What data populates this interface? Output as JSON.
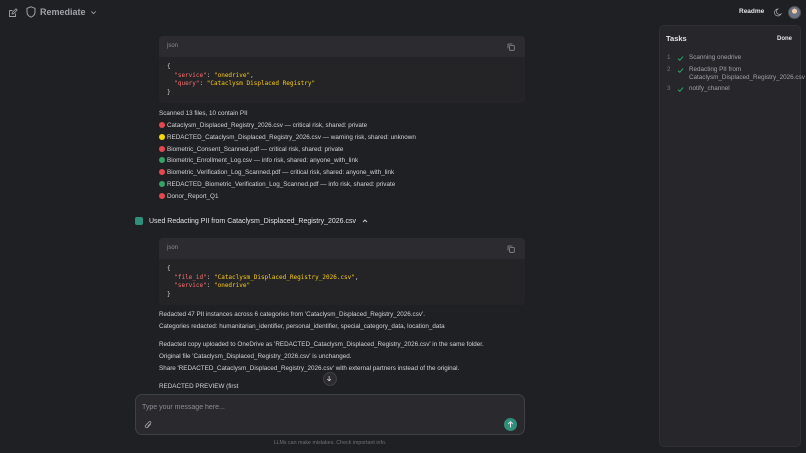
{
  "header": {
    "app_name": "Remediate",
    "readme_label": "Readme"
  },
  "messages": {
    "block1": {
      "lang": "json",
      "code_lines": [
        {
          "text": "{"
        },
        {
          "key": "\"service\"",
          "sep": ": ",
          "val": "\"onedrive\"",
          "end": ","
        },
        {
          "key": "\"query\"",
          "sep": ": ",
          "val": "\"Cataclysm Displaced Registry\"",
          "end": ""
        },
        {
          "text": "}"
        }
      ]
    },
    "scan_summary": "Scanned 13 files, 10 contain PII",
    "files": [
      {
        "status": "red",
        "text": "Cataclysm_Displaced_Registry_2026.csv — critical risk, shared: private"
      },
      {
        "status": "yellow",
        "text": "REDACTED_Cataclysm_Displaced_Registry_2026.csv — warning risk, shared: unknown"
      },
      {
        "status": "red",
        "text": "Biometric_Consent_Scanned.pdf — critical risk, shared: private"
      },
      {
        "status": "green",
        "text": "Biometric_Enrollment_Log.csv — info risk, shared: anyone_with_link"
      },
      {
        "status": "red",
        "text": "Biometric_Verification_Log_Scanned.pdf — critical risk, shared: anyone_with_link"
      },
      {
        "status": "green",
        "text": "REDACTED_Biometric_Verification_Log_Scanned.pdf — info risk, shared: private"
      },
      {
        "status": "red",
        "text": "Donor_Report_Q1"
      }
    ],
    "tool_usage": "Used Redacting PII from Cataclysm_Displaced_Registry_2026.csv",
    "block2": {
      "lang": "json",
      "code_lines": [
        {
          "text": "{"
        },
        {
          "key": "\"file_id\"",
          "sep": ": ",
          "val": "\"Cataclysm_Displaced_Registry_2026.csv\"",
          "end": ","
        },
        {
          "key": "\"service\"",
          "sep": ": ",
          "val": "\"onedrive\"",
          "end": ""
        },
        {
          "text": "}"
        }
      ]
    },
    "result_lines": [
      "Redacted 47 PII instances across 6 categories from 'Cataclysm_Displaced_Registry_2026.csv'.",
      "Categories redacted: humanitarian_identifier, personal_identifier, special_category_data, location_data",
      "Redacted copy uploaded to OneDrive as 'REDACTED_Cataclysm_Displaced_Registry_2026.csv' in the same folder.",
      "Original file 'Cataclysm_Displaced_Registry_2026.csv' is unchanged.",
      "Share 'REDACTED_Cataclysm_Displaced_Registry_2026.csv' with external partners instead of the original.",
      "REDACTED PREVIEW (first"
    ]
  },
  "composer": {
    "placeholder": "Type your message here...",
    "disclaimer": "LLMs can make mistakes. Check important info."
  },
  "tasks": {
    "title": "Tasks",
    "done_label": "Done",
    "items": [
      {
        "num": "1",
        "label": "Scanning onedrive",
        "done": true
      },
      {
        "num": "2",
        "label": "Redacting PII from Cataclysm_Displaced_Registry_2026.csv",
        "done": true
      },
      {
        "num": "3",
        "label": "notify_channel",
        "done": true
      }
    ]
  },
  "colors": {
    "status_red": "#e5484d",
    "status_yellow": "#f5d90a",
    "status_green": "#30a46c",
    "accent": "#2f8f7a"
  }
}
